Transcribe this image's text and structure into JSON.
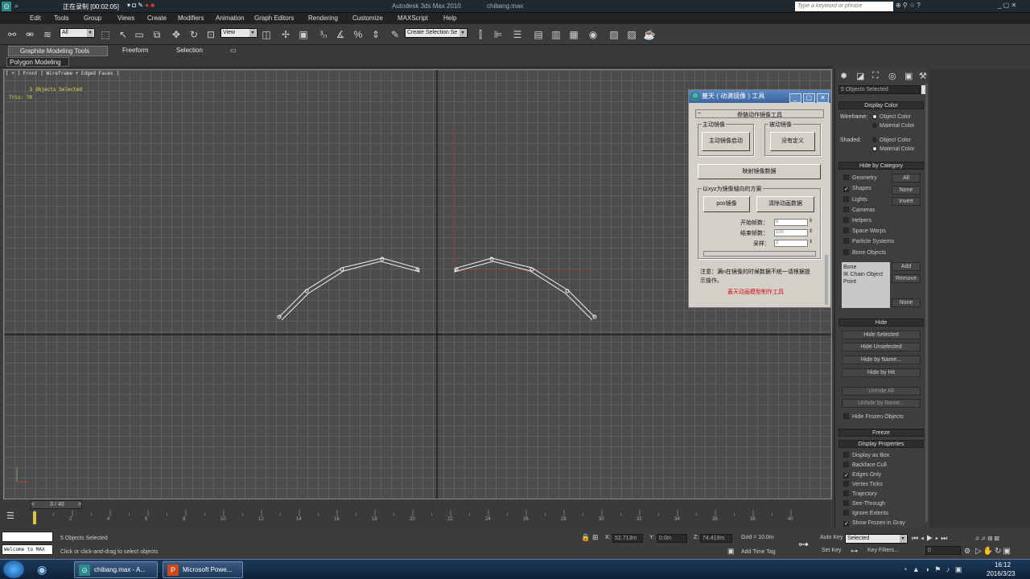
{
  "titlebar": {
    "recording": "正在录制 [00:02:05]",
    "app_title": "Autodesk 3ds Max  2010",
    "file_name": "chibang.max",
    "search_placeholder": "Type a keyword or phrase"
  },
  "menu": [
    "Edit",
    "Tools",
    "Group",
    "Views",
    "Create",
    "Modifiers",
    "Animation",
    "Graph Editors",
    "Rendering",
    "Customize",
    "MAXScript",
    "Help"
  ],
  "toolbar": {
    "filter_value": "All",
    "view_value": "View",
    "selection_set_value": "Create Selection Se"
  },
  "ribbon": {
    "tabs": [
      "Graphite Modeling Tools",
      "Freeform",
      "Selection"
    ],
    "subtab": "Polygon Modeling"
  },
  "viewport": {
    "label": "[ + ] Front  [ Wireframe + Edged Faces ]",
    "selection_info": "5 Objects Selected",
    "tris": "Tris:  70"
  },
  "dialog": {
    "title": "蓋天 ( 动满镜像 ) 工具",
    "section_title": "骨骼动作镜像工具",
    "active_group": "主动镜像",
    "active_button": "主动镜像启动",
    "passive_group": "被动镜像",
    "passive_button": "没有定义",
    "wide_button": "映射镜像数据",
    "axis_group": "以xyz为镜像轴向的方案",
    "pos_button": "pos镜像",
    "clear_button": "清除动画数据",
    "start_frame_label": "开始帧数：",
    "start_frame_value": "0",
    "end_frame_label": "结束帧数：",
    "end_frame_value": "100",
    "sample_label": "采样：",
    "sample_value": "2",
    "note": "注意：满n在镜像的时候数据不统一请根据提示操作。",
    "red_text": "蓋天动画模型制作工具"
  },
  "command_panel": {
    "selection_field": "5 Objects Selected",
    "display_color": "Display Color",
    "wireframe_label": "Wireframe:",
    "shaded_label": "Shaded:",
    "object_color": "Object Color",
    "material_color": "Material Color",
    "hide_by_category": "Hide by Category",
    "categories": [
      {
        "label": "Geometry",
        "checked": false
      },
      {
        "label": "Shapes",
        "checked": true
      },
      {
        "label": "Lights",
        "checked": false
      },
      {
        "label": "Cameras",
        "checked": false
      },
      {
        "label": "Helpers",
        "checked": false
      },
      {
        "label": "Space Warps",
        "checked": false
      },
      {
        "label": "Particle Systems",
        "checked": false
      },
      {
        "label": "Bone Objects",
        "checked": false
      }
    ],
    "all_btn": "All",
    "none_btn": "None",
    "invert_btn": "Invert",
    "list_items": [
      "Bone",
      "IK Chain Object",
      "Point"
    ],
    "add_btn": "Add",
    "remove_btn": "Remove",
    "none2_btn": "None",
    "hide": "Hide",
    "hide_buttons": [
      "Hide Selected",
      "Hide Unselected",
      "Hide by Name...",
      "Hide by Hit"
    ],
    "unhide_buttons": [
      "Unhide All",
      "Unhide by Name..."
    ],
    "hide_frozen": "Hide Frozen Objects",
    "freeze": "Freeze",
    "display_properties": "Display Properties",
    "props": [
      {
        "label": "Display as Box",
        "checked": false
      },
      {
        "label": "Backface Cull",
        "checked": false
      },
      {
        "label": "Edges Only",
        "checked": true
      },
      {
        "label": "Vertex Ticks",
        "checked": false
      },
      {
        "label": "Trajectory",
        "checked": false
      },
      {
        "label": "See-Through",
        "checked": false
      },
      {
        "label": "Ignore Extents",
        "checked": false
      },
      {
        "label": "Show Frozen in Gray",
        "checked": true
      }
    ]
  },
  "timeline": {
    "frame_counter": "0 / 40",
    "ticks": [
      "0",
      "2",
      "4",
      "6",
      "8",
      "10",
      "12",
      "14",
      "16",
      "18",
      "20",
      "22",
      "24",
      "26",
      "28",
      "30",
      "32",
      "34",
      "36",
      "38",
      "40"
    ]
  },
  "status": {
    "welcome": "Welcome to MAX",
    "selected": "5 Objects Selected",
    "hint": "Click or click-and-drag to select objects",
    "x_label": "X:",
    "x_value": "52.713m",
    "y_label": "Y:",
    "y_value": "0.0m",
    "z_label": "Z:",
    "z_value": "74.419m",
    "grid": "Grid = 10.0m",
    "add_time_tag": "Add Time Tag",
    "auto_key": "Auto Key",
    "auto_key_value": "Selected",
    "set_key": "Set Key",
    "key_filters": "Key Filters...",
    "frame_value": "0"
  },
  "taskbar": {
    "tasks": [
      "chibang.max - A...",
      "Microsoft Powe..."
    ],
    "time": "16:12",
    "date": "2016/3/23"
  }
}
